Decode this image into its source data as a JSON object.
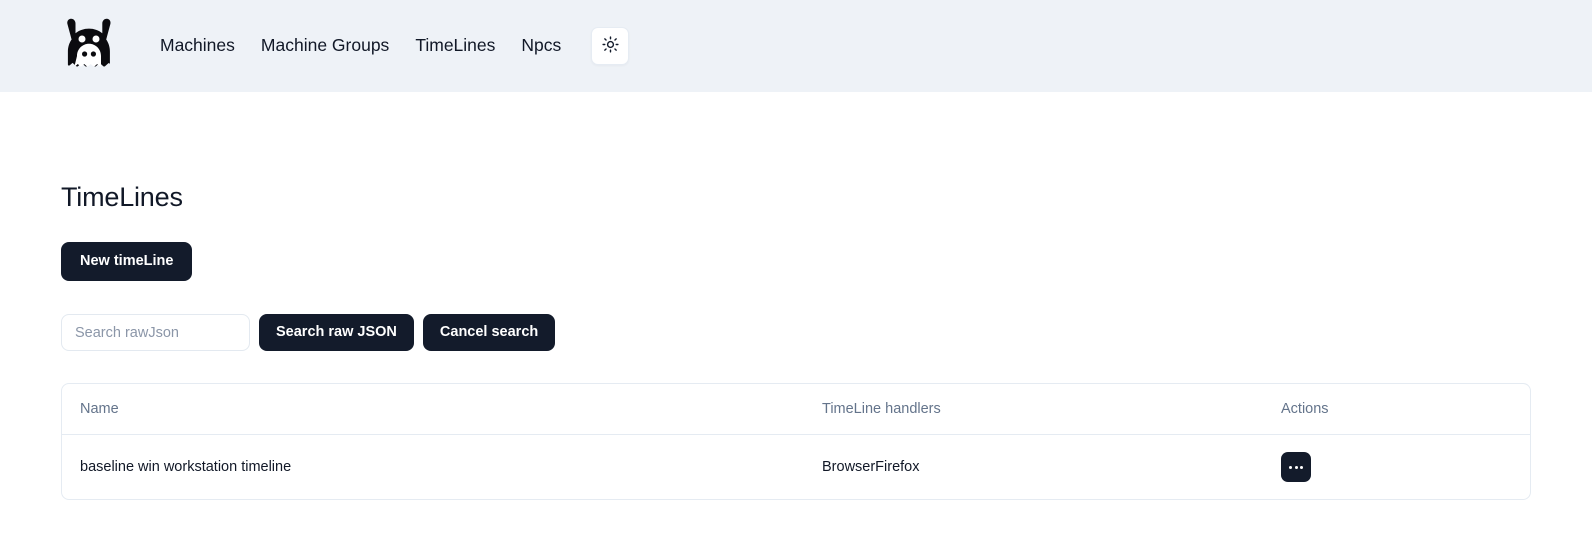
{
  "navbar": {
    "logo_name": "ghost-monster-logo",
    "links": [
      {
        "label": "Machines"
      },
      {
        "label": "Machine Groups"
      },
      {
        "label": "TimeLines"
      },
      {
        "label": "Npcs"
      }
    ],
    "theme_toggle": {
      "icon": "sun-icon",
      "title": "Toggle theme"
    },
    "background_color": "#eef2f7"
  },
  "main": {
    "page_title": "TimeLines",
    "new_button_label": "New timeLine",
    "search": {
      "placeholder": "Search rawJson",
      "value": "",
      "search_button_label": "Search raw JSON",
      "cancel_button_label": "Cancel search"
    },
    "table": {
      "columns": [
        {
          "label": "Name"
        },
        {
          "label": "TimeLine handlers"
        },
        {
          "label": "Actions"
        }
      ],
      "rows": [
        {
          "name": "baseline win workstation timeline",
          "handlers": "BrowserFirefox",
          "action_label": "···"
        }
      ]
    }
  },
  "colors": {
    "accent_dark": "#131b2b",
    "header_bg": "#eef2f7",
    "muted_text": "#64748b",
    "border": "#e5ebf2",
    "page_bg": "#ffffff"
  }
}
